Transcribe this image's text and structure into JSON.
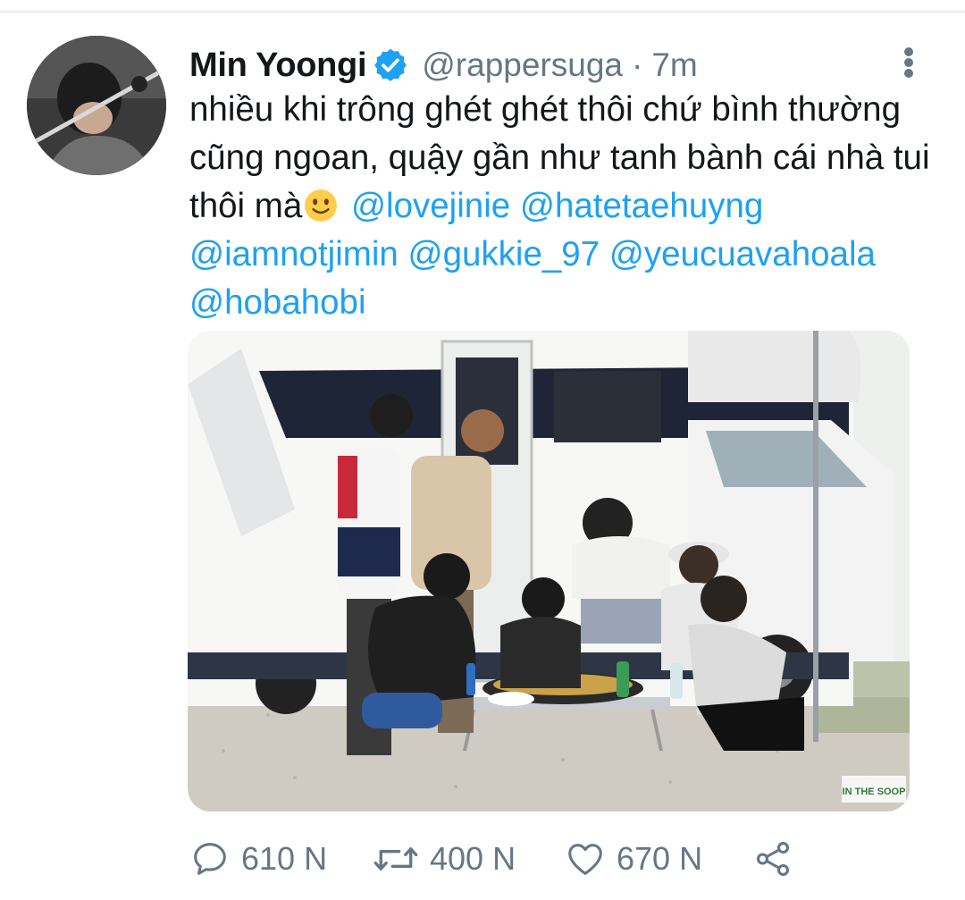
{
  "tweet": {
    "display_name": "Min Yoongi",
    "handle": "@rappersuga",
    "separator": "·",
    "time": "7m",
    "text_before_emoji": "nhiều khi trông ghét ghét thôi chứ bình thường cũng ngoan, quậy gần như tanh bành cái nhà tui thôi mà",
    "emoji_name": "slightly-smiling-face",
    "mentions": [
      "@lovejinie",
      "@hatetaehuyng",
      "@iamnotjimin",
      "@gukkie_97",
      "@yeucuavahoala",
      "@hobahobi"
    ],
    "media": {
      "watermark": "IN THE SOOP",
      "description_icon": "photo"
    }
  },
  "actions": {
    "reply_count": "610 N",
    "retweet_count": "400 N",
    "like_count": "670 N"
  },
  "icons": {
    "reply": "reply-icon",
    "retweet": "retweet-icon",
    "like": "heart-icon",
    "share": "share-icon",
    "more": "more-vertical-icon",
    "verified": "verified-badge-icon"
  },
  "colors": {
    "name": "#14171a",
    "secondary": "#657786",
    "mention": "#1da1f2",
    "verified": "#1da1f2",
    "divider": "#e6ecf0"
  }
}
